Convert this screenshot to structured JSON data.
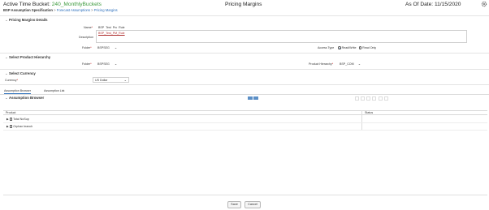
{
  "header": {
    "bucket_label": "Active Time Bucket:",
    "bucket_value": "240_MonthlyBuckets",
    "page_title": "Pricing Margins",
    "as_of_label": "As Of Date:",
    "as_of_value": "11/15/2020"
  },
  "breadcrumb": {
    "items": [
      "BSP Assumption Specification",
      "Forecast Assumptions",
      "Pricing Margins"
    ],
    "separator": ">"
  },
  "pricing_margins_details": {
    "section_title": "Pricing Margins Details",
    "name_label": "Name",
    "name_value": "BSP_Test_Prc_Rule",
    "description_label": "Description",
    "description_value": "BSP_Test_PM_Rule",
    "folder_label": "Folder",
    "folder_value": "BSPSEG",
    "access_type_label": "Access Type",
    "access_options": [
      {
        "label": "Read/Write",
        "selected": true
      },
      {
        "label": "Read Only",
        "selected": false
      }
    ]
  },
  "product_hierarchy": {
    "section_title": "Select Product Hierarchy",
    "folder_label": "Folder",
    "folder_value": "BSPSEG",
    "hierarchy_label": "Product Hierarchy",
    "hierarchy_value": "BSP_COM"
  },
  "currency": {
    "section_title": "Select Currency",
    "currency_label": "Currency",
    "currency_value": "US Dollar"
  },
  "tabs": [
    {
      "label": "Assumption Browser",
      "active": true
    },
    {
      "label": "Assumption List",
      "active": false
    }
  ],
  "browser": {
    "section_title": "Assumption Browser",
    "columns": [
      "Product",
      "Status"
    ],
    "rows": [
      {
        "label": "Total NoSup",
        "status": ""
      },
      {
        "label": "Orphan branch",
        "status": ""
      }
    ]
  },
  "buttons": {
    "save": "Save",
    "cancel": "Cancel"
  },
  "colors": {
    "accent": "#2a6ebb",
    "bucket_green": "#3c9a3c",
    "required": "#cc0000"
  }
}
